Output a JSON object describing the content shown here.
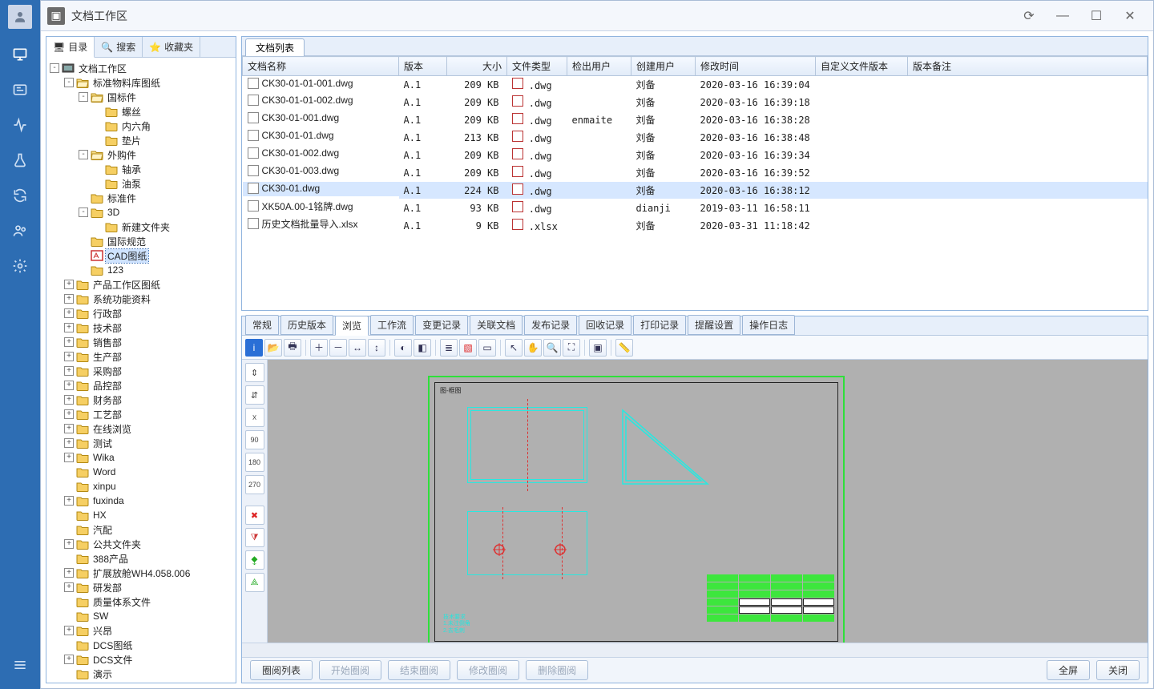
{
  "window": {
    "title": "文档工作区"
  },
  "leftTabs": {
    "dir": "目录",
    "search": "搜索",
    "fav": "收藏夹"
  },
  "tree": [
    {
      "d": 0,
      "t": "-",
      "ic": "ws",
      "label": "文档工作区"
    },
    {
      "d": 1,
      "t": "-",
      "ic": "fo",
      "label": "标准物料库图纸"
    },
    {
      "d": 2,
      "t": "-",
      "ic": "fo",
      "label": "国标件"
    },
    {
      "d": 3,
      "t": " ",
      "ic": "fc",
      "label": "螺丝"
    },
    {
      "d": 3,
      "t": " ",
      "ic": "fc",
      "label": "内六角"
    },
    {
      "d": 3,
      "t": " ",
      "ic": "fc",
      "label": "垫片"
    },
    {
      "d": 2,
      "t": "-",
      "ic": "fo",
      "label": "外购件"
    },
    {
      "d": 3,
      "t": " ",
      "ic": "fc",
      "label": "轴承"
    },
    {
      "d": 3,
      "t": " ",
      "ic": "fc",
      "label": "油泵"
    },
    {
      "d": 2,
      "t": " ",
      "ic": "fc",
      "label": "标准件"
    },
    {
      "d": 2,
      "t": "-",
      "ic": "fc",
      "label": "3D"
    },
    {
      "d": 3,
      "t": " ",
      "ic": "fc",
      "label": "新建文件夹"
    },
    {
      "d": 2,
      "t": " ",
      "ic": "fc",
      "label": "国际规范"
    },
    {
      "d": 2,
      "t": " ",
      "ic": "cad",
      "label": "CAD图纸",
      "sel": true
    },
    {
      "d": 2,
      "t": " ",
      "ic": "fc",
      "label": "123"
    },
    {
      "d": 1,
      "t": "+",
      "ic": "fc",
      "label": "产品工作区图纸"
    },
    {
      "d": 1,
      "t": "+",
      "ic": "fc",
      "label": "系统功能资料"
    },
    {
      "d": 1,
      "t": "+",
      "ic": "fc",
      "label": "行政部"
    },
    {
      "d": 1,
      "t": "+",
      "ic": "fc",
      "label": "技术部"
    },
    {
      "d": 1,
      "t": "+",
      "ic": "fc",
      "label": "销售部"
    },
    {
      "d": 1,
      "t": "+",
      "ic": "fc",
      "label": "生产部"
    },
    {
      "d": 1,
      "t": "+",
      "ic": "fc",
      "label": "采购部"
    },
    {
      "d": 1,
      "t": "+",
      "ic": "fc",
      "label": "品控部"
    },
    {
      "d": 1,
      "t": "+",
      "ic": "fc",
      "label": "财务部"
    },
    {
      "d": 1,
      "t": "+",
      "ic": "fc",
      "label": "工艺部"
    },
    {
      "d": 1,
      "t": "+",
      "ic": "fc",
      "label": "在线浏览"
    },
    {
      "d": 1,
      "t": "+",
      "ic": "fc",
      "label": "测试"
    },
    {
      "d": 1,
      "t": "+",
      "ic": "fc",
      "label": "Wika"
    },
    {
      "d": 1,
      "t": " ",
      "ic": "fc",
      "label": "Word"
    },
    {
      "d": 1,
      "t": " ",
      "ic": "fc",
      "label": "xinpu"
    },
    {
      "d": 1,
      "t": "+",
      "ic": "fc",
      "label": "fuxinda"
    },
    {
      "d": 1,
      "t": " ",
      "ic": "fc",
      "label": "HX"
    },
    {
      "d": 1,
      "t": " ",
      "ic": "fc",
      "label": "汽配"
    },
    {
      "d": 1,
      "t": "+",
      "ic": "fc",
      "label": "公共文件夹"
    },
    {
      "d": 1,
      "t": " ",
      "ic": "fc",
      "label": "388产品"
    },
    {
      "d": 1,
      "t": "+",
      "ic": "fc",
      "label": "扩展放舱WH4.058.006"
    },
    {
      "d": 1,
      "t": "+",
      "ic": "fc",
      "label": "研发部"
    },
    {
      "d": 1,
      "t": " ",
      "ic": "fc",
      "label": "质量体系文件"
    },
    {
      "d": 1,
      "t": " ",
      "ic": "fc",
      "label": "SW"
    },
    {
      "d": 1,
      "t": "+",
      "ic": "fc",
      "label": "兴昂"
    },
    {
      "d": 1,
      "t": " ",
      "ic": "fc",
      "label": "DCS图纸"
    },
    {
      "d": 1,
      "t": "+",
      "ic": "fc",
      "label": "DCS文件"
    },
    {
      "d": 1,
      "t": " ",
      "ic": "fc",
      "label": "演示"
    }
  ],
  "docListTab": "文档列表",
  "columns": {
    "name": "文档名称",
    "ver": "版本",
    "size": "大小",
    "type": "文件类型",
    "checkout": "检出用户",
    "creator": "创建用户",
    "mtime": "修改时间",
    "custom": "自定义文件版本",
    "remark": "版本备注"
  },
  "rows": [
    {
      "name": "CK30-01-01-001.dwg",
      "ver": "A.1",
      "size": "209 KB",
      "type": ".dwg",
      "checkout": "",
      "creator": "刘备",
      "mtime": "2020-03-16 16:39:04"
    },
    {
      "name": "CK30-01-01-002.dwg",
      "ver": "A.1",
      "size": "209 KB",
      "type": ".dwg",
      "checkout": "",
      "creator": "刘备",
      "mtime": "2020-03-16 16:39:18"
    },
    {
      "name": "CK30-01-001.dwg",
      "ver": "A.1",
      "size": "209 KB",
      "type": ".dwg",
      "checkout": "enmaite",
      "creator": "刘备",
      "mtime": "2020-03-16 16:38:28"
    },
    {
      "name": "CK30-01-01.dwg",
      "ver": "A.1",
      "size": "213 KB",
      "type": ".dwg",
      "checkout": "",
      "creator": "刘备",
      "mtime": "2020-03-16 16:38:48"
    },
    {
      "name": "CK30-01-002.dwg",
      "ver": "A.1",
      "size": "209 KB",
      "type": ".dwg",
      "checkout": "",
      "creator": "刘备",
      "mtime": "2020-03-16 16:39:34"
    },
    {
      "name": "CK30-01-003.dwg",
      "ver": "A.1",
      "size": "209 KB",
      "type": ".dwg",
      "checkout": "",
      "creator": "刘备",
      "mtime": "2020-03-16 16:39:52"
    },
    {
      "name": "CK30-01.dwg",
      "ver": "A.1",
      "size": "224 KB",
      "type": ".dwg",
      "checkout": "",
      "creator": "刘备",
      "mtime": "2020-03-16 16:38:12",
      "sel": true
    },
    {
      "name": "XK50A.00-1铭牌.dwg",
      "ver": "A.1",
      "size": "93 KB",
      "type": ".dwg",
      "checkout": "",
      "creator": "dianji",
      "mtime": "2019-03-11 16:58:11"
    },
    {
      "name": "历史文档批量导入.xlsx",
      "ver": "A.1",
      "size": "9 KB",
      "type": ".xlsx",
      "checkout": "",
      "creator": "刘备",
      "mtime": "2020-03-31 11:18:42"
    }
  ],
  "detailTabs": [
    "常规",
    "历史版本",
    "浏览",
    "工作流",
    "变更记录",
    "关联文档",
    "发布记录",
    "回收记录",
    "打印记录",
    "提醒设置",
    "操作日志"
  ],
  "detailActive": 2,
  "bottom": {
    "reviewList": "圈阅列表",
    "start": "开始圈阅",
    "end": "结束圈阅",
    "modify": "修改圈阅",
    "delete": "删除圈阅",
    "full": "全屏",
    "close": "关闭"
  },
  "drawing": {
    "label": "图-框图"
  }
}
